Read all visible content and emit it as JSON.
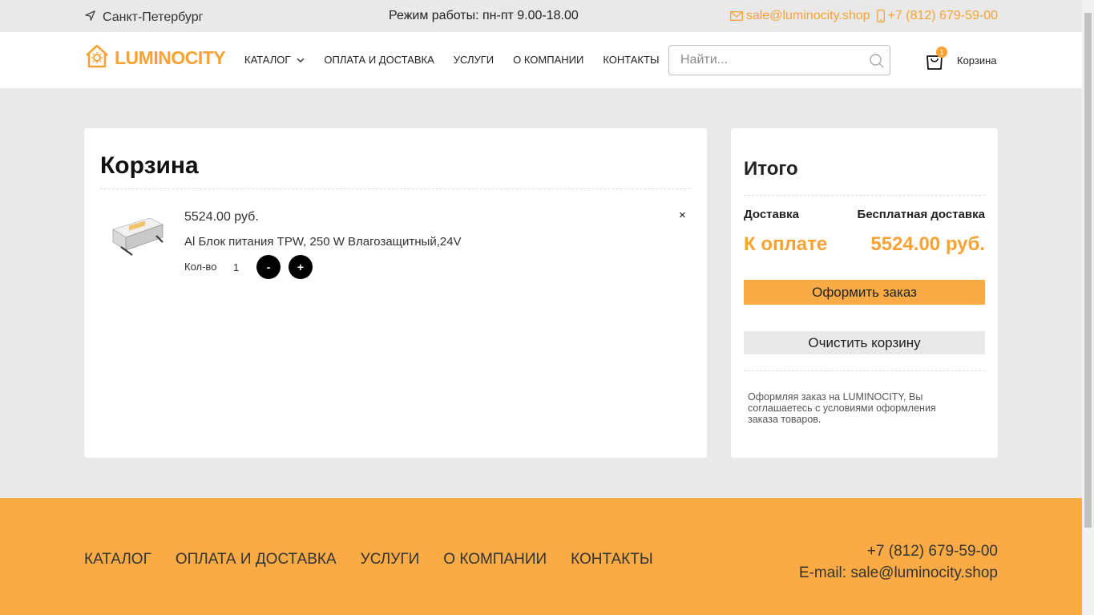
{
  "topbar": {
    "city": "Санкт-Петербург",
    "hours": "Режим работы: пн-пт 9.00-18.00",
    "email": "sale@luminocity.shop",
    "phone": "+7 (812) 679-59-00"
  },
  "header": {
    "logo_text": "LUMINOCITY",
    "nav": [
      "КАТАЛОГ",
      "ОПЛАТА И ДОСТАВКА",
      "УСЛУГИ",
      "О КОМПАНИИ",
      "КОНТАКТЫ"
    ],
    "search_placeholder": "Найти...",
    "cart_label": "Корзина",
    "cart_count": "1"
  },
  "cart": {
    "title": "Корзина",
    "item": {
      "price": "5524.00 руб.",
      "name": "Al Блок питания TPW, 250 W Влагозащитный,24V",
      "qty_label": "Кол-во",
      "qty": "1",
      "minus": "-",
      "plus": "+",
      "remove": "×"
    }
  },
  "summary": {
    "title": "Итого",
    "delivery_label": "Доставка",
    "delivery_value": "Бесплатная доставка",
    "pay_label": "К оплате",
    "pay_value": "5524.00 руб.",
    "order_button": "Оформить заказ",
    "clear_button": "Очистить корзину",
    "terms": "Оформляя заказ на LUMINOCITY, Вы соглашаетесь с условиями оформления заказа товаров."
  },
  "footer": {
    "nav": [
      "КАТАЛОГ",
      "ОПЛАТА И ДОСТАВКА",
      "УСЛУГИ",
      "О КОМПАНИИ",
      "КОНТАКТЫ"
    ],
    "phone": "+7 (812) 679-59-00",
    "email": "E-mail: sale@luminocity.shop"
  },
  "colors": {
    "accent": "#f7a233",
    "footer_bg": "#fbab45",
    "page_bg": "#e9e9e9"
  }
}
